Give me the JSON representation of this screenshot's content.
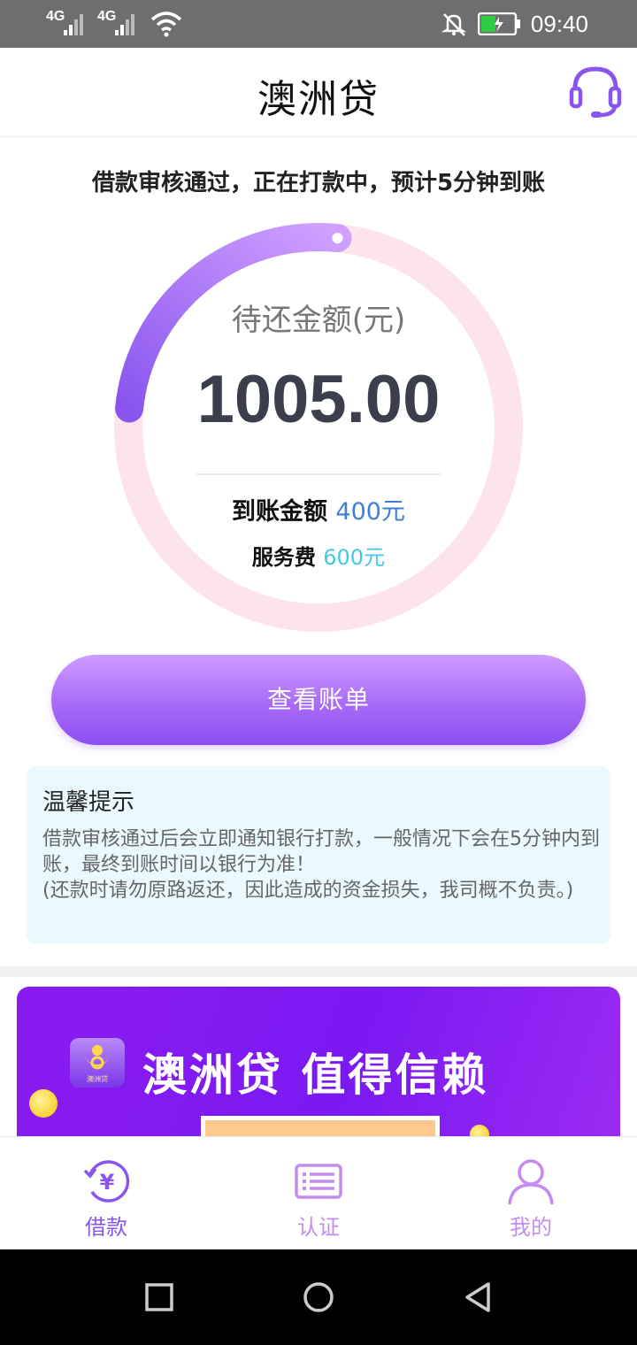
{
  "status_bar": {
    "signal1": "4G",
    "signal2": "4G",
    "time": "09:40"
  },
  "header": {
    "title": "澳洲贷",
    "support_icon": "headset-icon"
  },
  "notice": "借款审核通过，正在打款中，预计5分钟到账",
  "loan_ring": {
    "progress_fraction": 0.25,
    "label": "待还金额(元)",
    "amount": "1005.00",
    "received_label": "到账金额",
    "received_value": "400元",
    "fee_label": "服务费",
    "fee_value": "600元"
  },
  "view_bill_button": "查看账单",
  "tips": {
    "title": "温馨提示",
    "line1": "借款审核通过后会立即通知银行打款，一般情况下会在5分钟内到账，最终到账时间以银行为准！",
    "line2": "(还款时请勿原路返还，因此造成的资金损失，我司概不负责。)"
  },
  "banner": {
    "text": "澳洲贷 值得信赖",
    "logo_text": "澳洲贷"
  },
  "tabbar": {
    "items": [
      {
        "label": "借款",
        "icon": "loan-yuan-icon",
        "active": true
      },
      {
        "label": "认证",
        "icon": "id-card-icon",
        "active": false
      },
      {
        "label": "我的",
        "icon": "user-icon",
        "active": false
      }
    ]
  },
  "colors": {
    "accent_purple": "#8a55ef",
    "ring_track": "#fde3ea",
    "received_blue": "#3f7fd8",
    "fee_cyan": "#45c7e4",
    "tab_inactive": "#c58cf0"
  }
}
